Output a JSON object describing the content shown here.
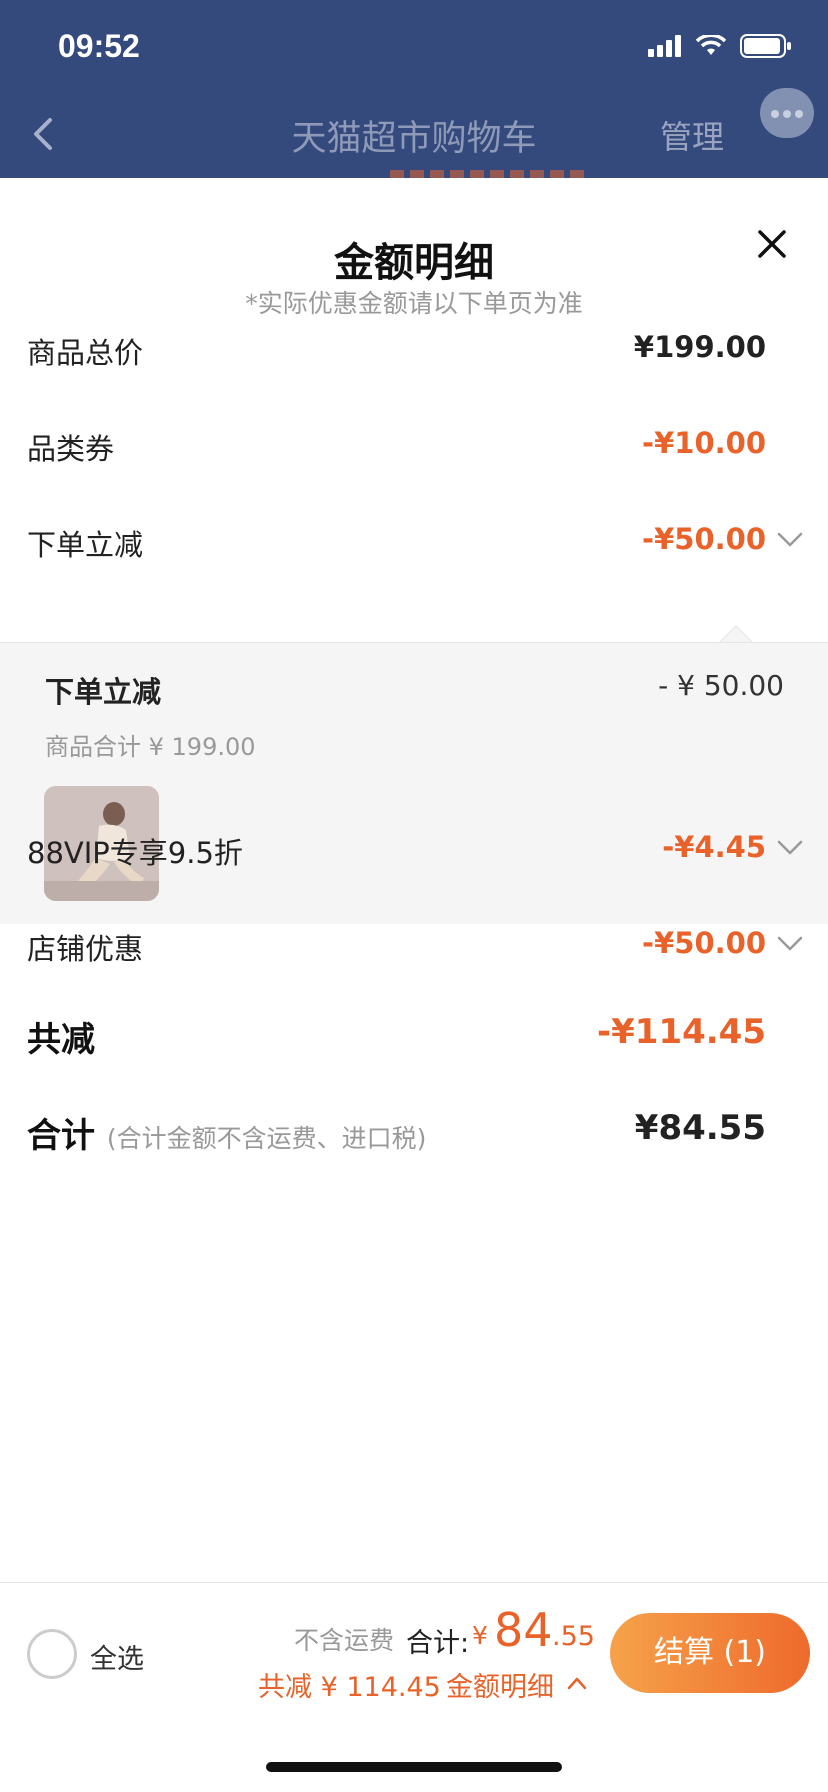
{
  "status_bar": {
    "time": "09:52"
  },
  "nav": {
    "title": "天猫超市购物车",
    "manage_label": "管理"
  },
  "sheet": {
    "title": "金额明细",
    "subtitle": "*实际优惠金额请以下单页为准",
    "rows": [
      {
        "label": "商品总价",
        "value": "¥199.00"
      },
      {
        "label": "品类券",
        "value": "-¥10.00"
      },
      {
        "label": "下单立减",
        "value": "-¥50.00"
      },
      {
        "label": "88VIP专享9.5折",
        "value": "-¥4.45"
      },
      {
        "label": "店铺优惠",
        "value": "-¥50.00"
      }
    ],
    "detail": {
      "title": "下单立减",
      "amount": "- ¥ 50.00",
      "subtotal": "商品合计 ¥ 199.00"
    },
    "total_saved": {
      "label": "共减",
      "value": "-¥114.45"
    },
    "total": {
      "label": "合计",
      "note": "(合计金额不含运费、进口税)",
      "value": "¥84.55"
    }
  },
  "bottom_bar": {
    "select_all": "全选",
    "excl_shipping": "不含运费",
    "total_label": "合计:",
    "currency": "¥",
    "total_int": "84",
    "total_dec": ".55",
    "saved_text": "共减 ¥ 114.45",
    "detail_link": "金额明细",
    "checkout": "结算 (1)"
  },
  "colors": {
    "accent": "#e8622a",
    "header": "#34497c",
    "checkout_start": "#f6a24a",
    "checkout_end": "#ee6a2c"
  },
  "icons": [
    "back-arrow-icon",
    "more-icon",
    "close-icon",
    "chevron-down-icon",
    "chevron-up-icon",
    "signal-icon",
    "wifi-icon",
    "battery-icon"
  ]
}
